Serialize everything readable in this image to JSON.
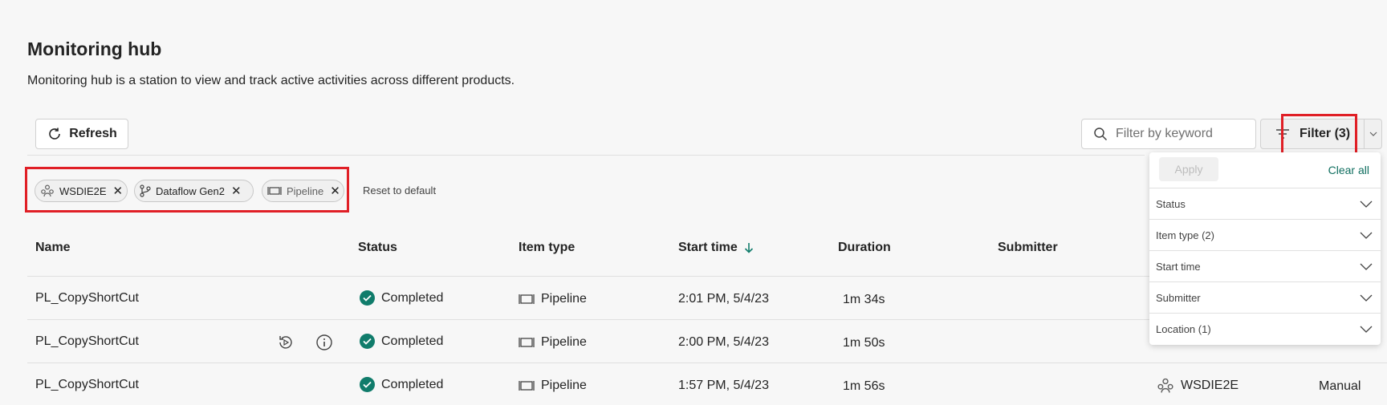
{
  "header": {
    "title": "Monitoring hub",
    "subtitle": "Monitoring hub is a station to view and track active activities across different products."
  },
  "toolbar": {
    "refresh_label": "Refresh",
    "search_placeholder": "Filter by keyword",
    "filter_label": "Filter (3)"
  },
  "chips": [
    {
      "label": "WSDIE2E",
      "icon": "workspace-icon"
    },
    {
      "label": "Dataflow Gen2",
      "icon": "dataflow-icon"
    },
    {
      "label": "Pipeline",
      "icon": "pipeline-icon"
    }
  ],
  "reset_label": "Reset to default",
  "table": {
    "columns": [
      "Name",
      "Status",
      "Item type",
      "Start time",
      "Duration",
      "Submitter"
    ],
    "rows": [
      {
        "name": "PL_CopyShortCut",
        "status": "Completed",
        "item_type": "Pipeline",
        "start_time": "2:01 PM, 5/4/23",
        "duration": "1m 34s",
        "location": "",
        "submitter": ""
      },
      {
        "name": "PL_CopyShortCut",
        "status": "Completed",
        "item_type": "Pipeline",
        "start_time": "2:00 PM, 5/4/23",
        "duration": "1m 50s",
        "location": "",
        "submitter": ""
      },
      {
        "name": "PL_CopyShortCut",
        "status": "Completed",
        "item_type": "Pipeline",
        "start_time": "1:57 PM, 5/4/23",
        "duration": "1m 56s",
        "location": "WSDIE2E",
        "submitter": "Manual"
      }
    ]
  },
  "filter_panel": {
    "apply_label": "Apply",
    "clear_label": "Clear all",
    "sections": [
      "Status",
      "Item type (2)",
      "Start time",
      "Submitter",
      "Location (1)"
    ]
  },
  "colors": {
    "accent": "#0f6e5f",
    "status_ok": "#107c6b",
    "highlight": "#e01f26"
  }
}
